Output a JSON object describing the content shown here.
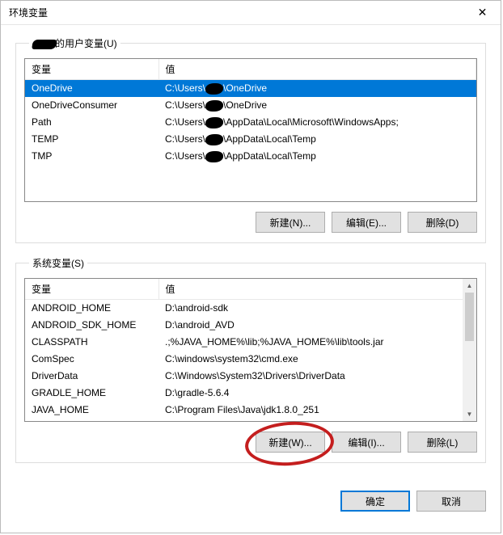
{
  "window": {
    "title": "环境变量",
    "close_glyph": "✕"
  },
  "user_vars": {
    "legend_suffix": "的用户变量(U)",
    "columns": {
      "name": "变量",
      "value": "值"
    },
    "rows": [
      {
        "name": "OneDrive",
        "value_pre": "C:\\Users\\",
        "value_post": "\\OneDrive",
        "selected": true
      },
      {
        "name": "OneDriveConsumer",
        "value_pre": "C:\\Users\\",
        "value_post": "\\OneDrive"
      },
      {
        "name": "Path",
        "value_pre": "C:\\Users\\",
        "value_post": "\\AppData\\Local\\Microsoft\\WindowsApps;"
      },
      {
        "name": "TEMP",
        "value_pre": "C:\\Users\\",
        "value_post": "\\AppData\\Local\\Temp"
      },
      {
        "name": "TMP",
        "value_pre": "C:\\Users\\",
        "value_post": "\\AppData\\Local\\Temp"
      }
    ],
    "buttons": {
      "new": "新建(N)...",
      "edit": "编辑(E)...",
      "delete": "删除(D)"
    }
  },
  "system_vars": {
    "legend": "系统变量(S)",
    "columns": {
      "name": "变量",
      "value": "值"
    },
    "rows": [
      {
        "name": "ANDROID_HOME",
        "value": "D:\\android-sdk"
      },
      {
        "name": "ANDROID_SDK_HOME",
        "value": "D:\\android_AVD"
      },
      {
        "name": "CLASSPATH",
        "value": ".;%JAVA_HOME%\\lib;%JAVA_HOME%\\lib\\tools.jar"
      },
      {
        "name": "ComSpec",
        "value": "C:\\windows\\system32\\cmd.exe"
      },
      {
        "name": "DriverData",
        "value": "C:\\Windows\\System32\\Drivers\\DriverData"
      },
      {
        "name": "GRADLE_HOME",
        "value": "D:\\gradle-5.6.4"
      },
      {
        "name": "JAVA_HOME",
        "value": "C:\\Program Files\\Java\\jdk1.8.0_251"
      }
    ],
    "buttons": {
      "new": "新建(W)...",
      "edit": "编辑(I)...",
      "delete": "删除(L)"
    }
  },
  "footer": {
    "ok": "确定",
    "cancel": "取消"
  }
}
